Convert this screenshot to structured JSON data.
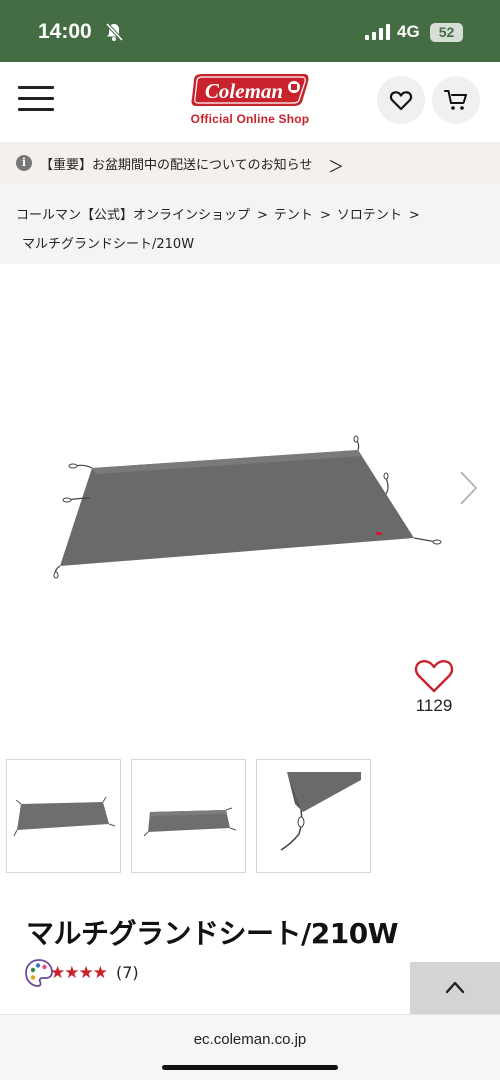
{
  "status_bar": {
    "time": "14:00",
    "network": "4G",
    "battery": "52",
    "icons": [
      "bell-off-icon",
      "signal-icon"
    ]
  },
  "header": {
    "logo_text": "Coleman",
    "logo_subtitle": "Official Online Shop",
    "icons": [
      "menu-icon",
      "heart-icon",
      "cart-icon"
    ],
    "brand_color": "#c8232c"
  },
  "notice": {
    "text": "【重要】お盆期間中の配送についてのお知らせ",
    "chevron": "＞"
  },
  "breadcrumb": {
    "items": [
      "コールマン【公式】オンラインショップ",
      "テント",
      "ソロテント"
    ],
    "separator": ">",
    "current": "マルチグランドシート/210W"
  },
  "gallery": {
    "favorite_count": "1129",
    "thumbnails": [
      "thumbnail-sheet-front",
      "thumbnail-sheet-angle",
      "thumbnail-sheet-corner-detail"
    ]
  },
  "product": {
    "title": "マルチグランドシート/210W",
    "stars": "★★★★",
    "review_count": "(7)"
  },
  "browser": {
    "url": "ec.coleman.co.jp"
  },
  "colors": {
    "status_bar": "#456d43",
    "accent_red": "#c8232c",
    "sheet_gray": "#666666"
  }
}
